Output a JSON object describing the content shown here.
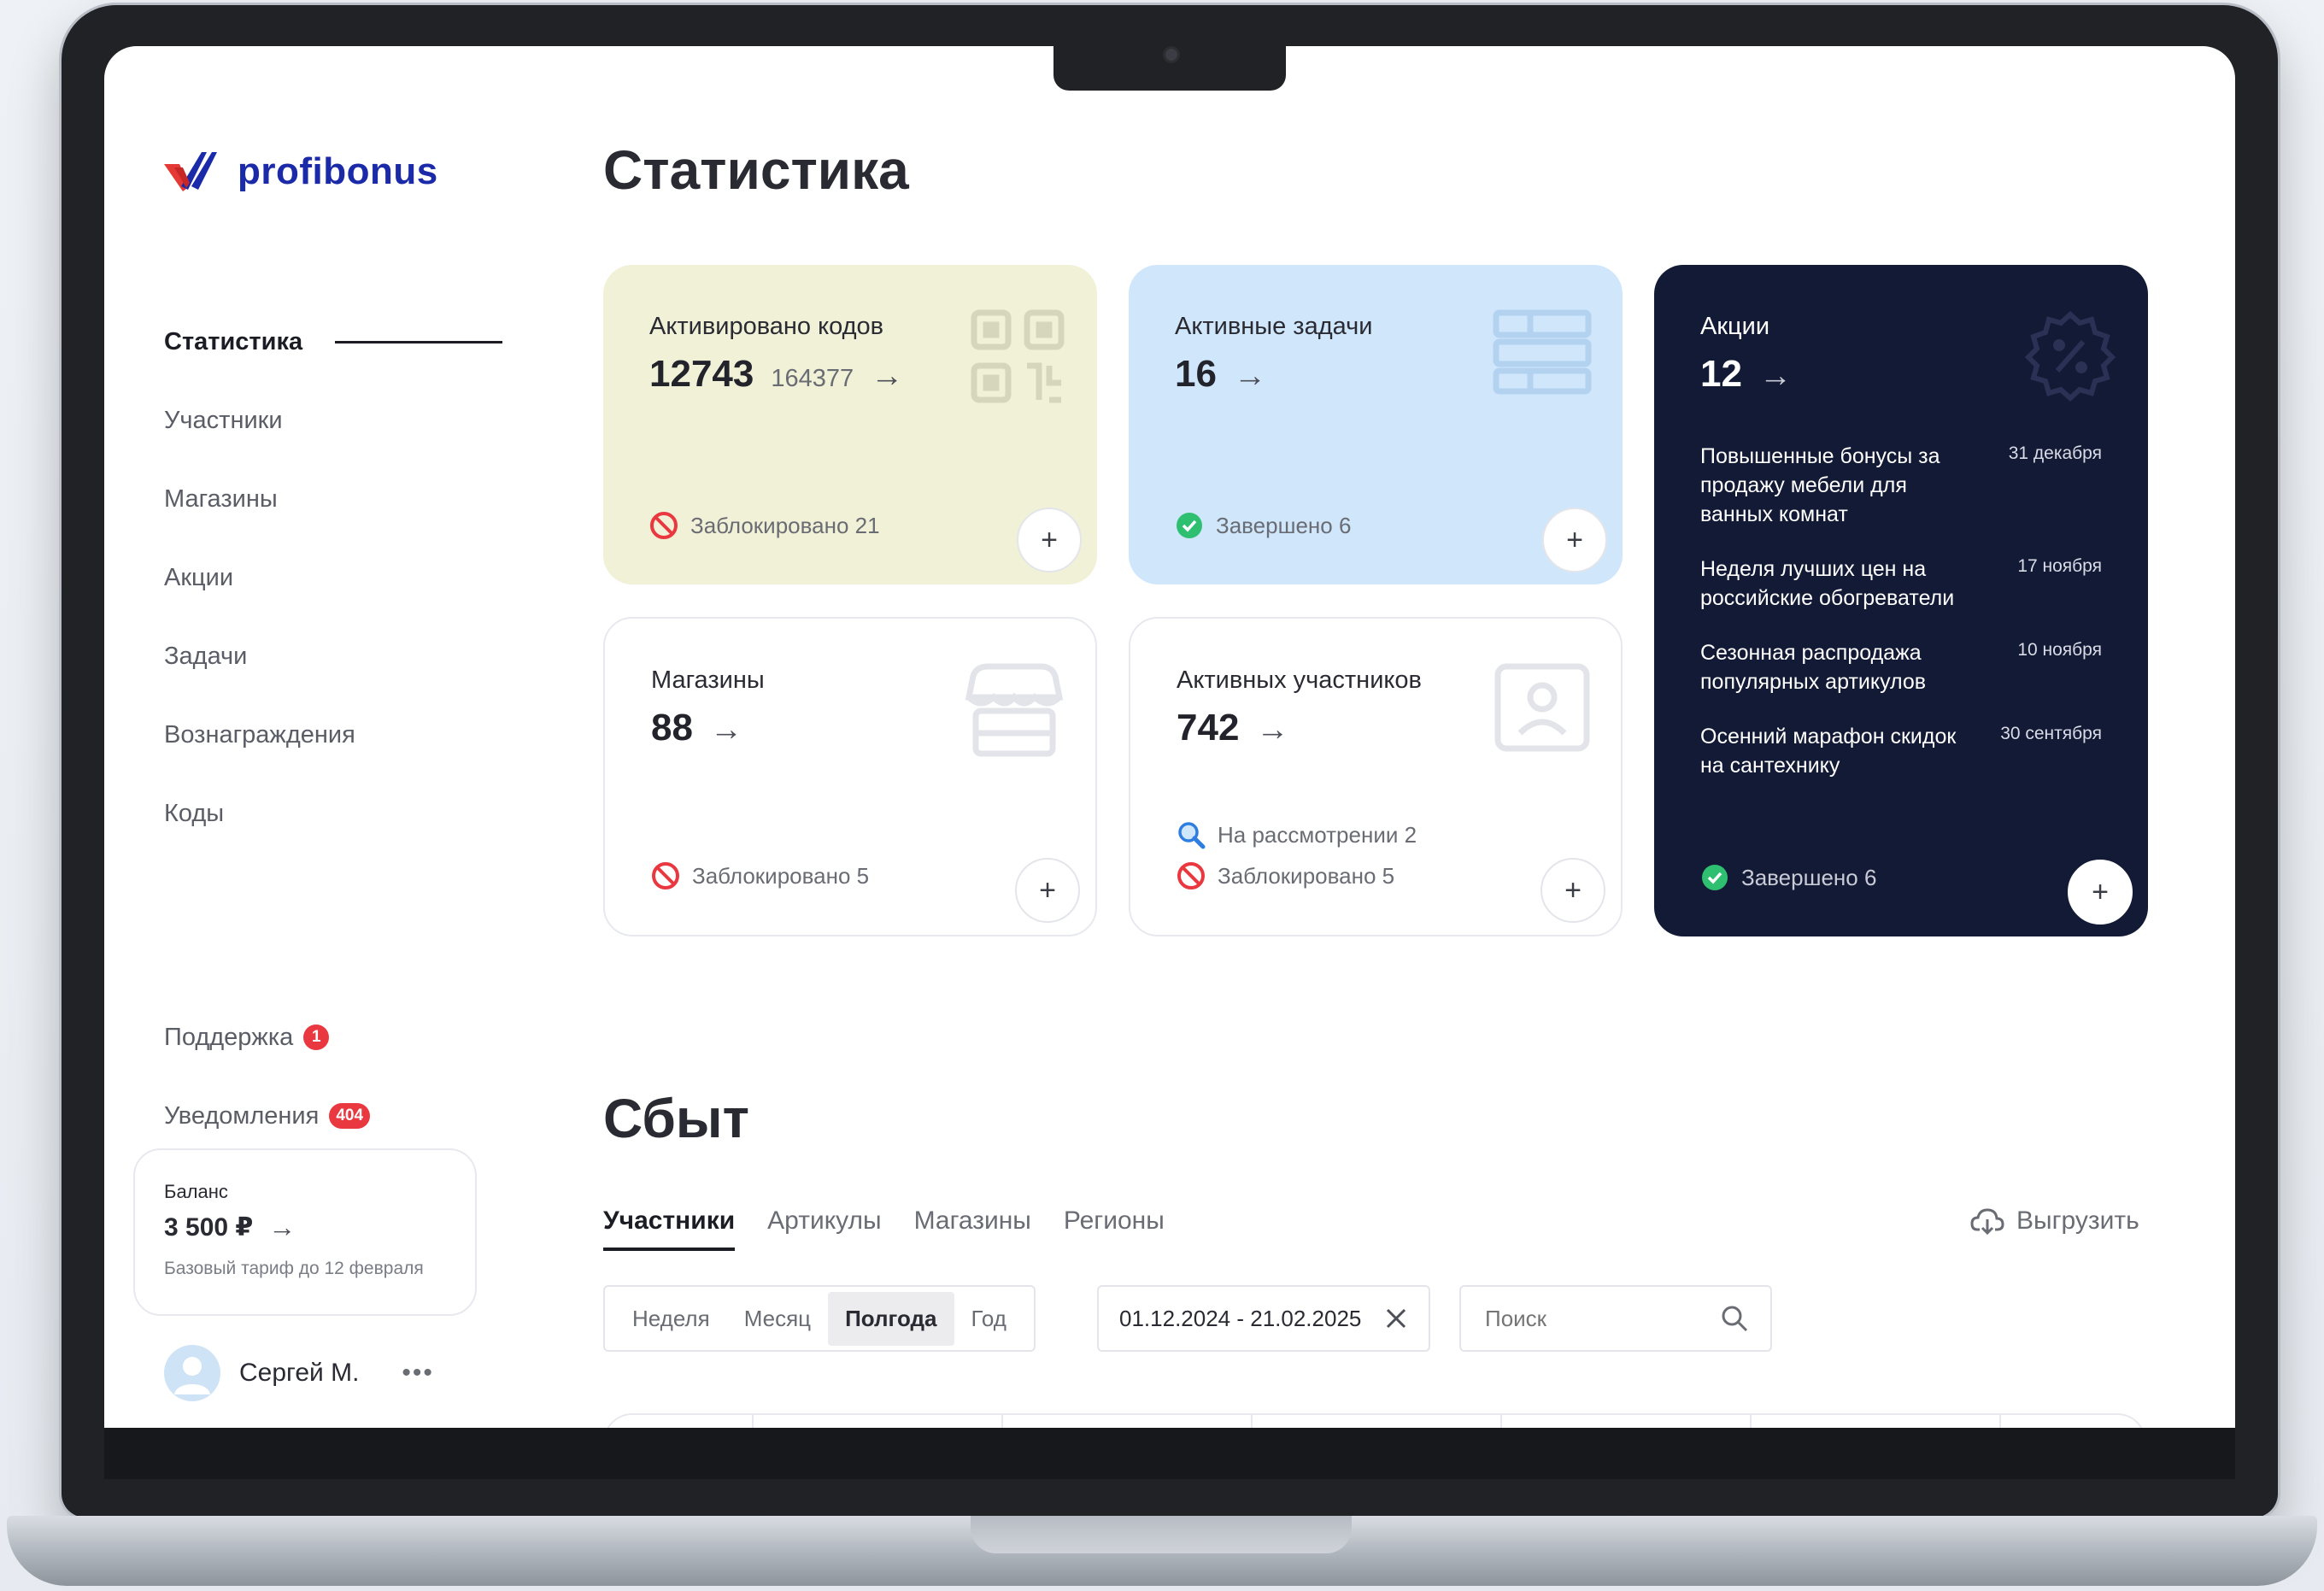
{
  "brand": {
    "name": "profibonus"
  },
  "sidebar": {
    "items": [
      {
        "label": "Статистика",
        "active": true
      },
      {
        "label": "Участники"
      },
      {
        "label": "Магазины"
      },
      {
        "label": "Акции"
      },
      {
        "label": "Задачи"
      },
      {
        "label": "Вознаграждения"
      },
      {
        "label": "Коды"
      }
    ],
    "support": {
      "label": "Поддержка",
      "badge": "1"
    },
    "notifications": {
      "label": "Уведомления",
      "badge": "404"
    },
    "balance": {
      "title": "Баланс",
      "amount": "3 500 ₽",
      "note": "Базовый тариф до 12 февраля"
    },
    "user": {
      "name": "Сергей М."
    }
  },
  "page": {
    "title": "Статистика"
  },
  "cards": {
    "codes": {
      "label": "Активировано кодов",
      "value": "12743",
      "total": "164377",
      "status": "Заблокировано 21",
      "icon": "qr-code-icon",
      "color": "#f1f1d7"
    },
    "tasks": {
      "label": "Активные задачи",
      "value": "16",
      "status": "Завершено 6",
      "icon": "tasks-grid-icon",
      "color": "#cfe6fb"
    },
    "shops": {
      "label": "Магазины",
      "value": "88",
      "status": "Заблокировано 5",
      "icon": "shop-icon"
    },
    "participants": {
      "label": "Активных участников",
      "value": "742",
      "status_review": "На рассмотрении 2",
      "status_blocked": "Заблокировано 5",
      "icon": "user-profile-icon"
    },
    "promos": {
      "label": "Акции",
      "value": "12",
      "status": "Завершено 6",
      "icon": "discount-badge-icon",
      "color": "#131a35",
      "items": [
        {
          "text": "Повышенные бонусы за продажу мебели для ванных комнат",
          "date": "31 декабря"
        },
        {
          "text": "Неделя лучших цен на российские обогреватели",
          "date": "17 ноября"
        },
        {
          "text": "Сезонная распродажа популярных артикулов",
          "date": "10 ноября"
        },
        {
          "text": "Осенний марафон скидок на сантехнику",
          "date": "30 сентября"
        }
      ]
    }
  },
  "sales": {
    "title": "Сбыт",
    "tabs": [
      {
        "label": "Участники",
        "active": true
      },
      {
        "label": "Артикулы"
      },
      {
        "label": "Магазины"
      },
      {
        "label": "Регионы"
      }
    ],
    "export_label": "Выгрузить",
    "periods": [
      {
        "label": "Неделя"
      },
      {
        "label": "Месяц"
      },
      {
        "label": "Полгода",
        "active": true
      },
      {
        "label": "Год"
      }
    ],
    "date_range": "01.12.2024 - 21.02.2025",
    "search_placeholder": "Поиск"
  },
  "colors": {
    "accent": "#1a2aa8",
    "danger": "#e9383f",
    "success": "#2fbf71",
    "dark_card": "#131a35"
  }
}
